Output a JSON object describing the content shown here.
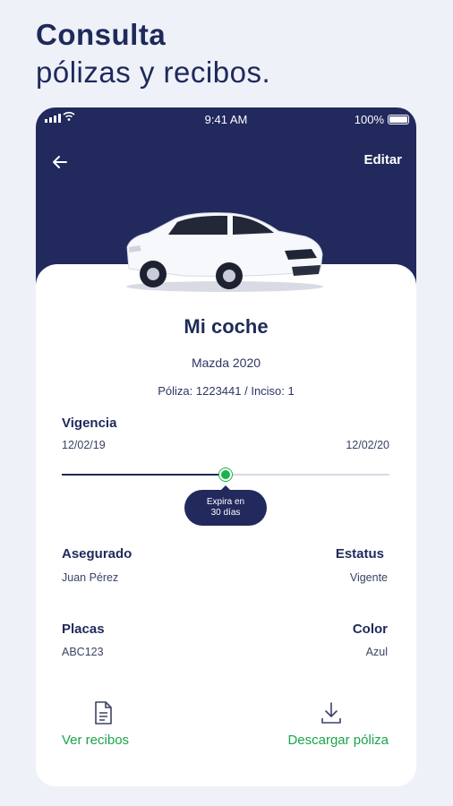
{
  "headline": {
    "line1": "Consulta",
    "line2": "pólizas y recibos."
  },
  "statusbar": {
    "time": "9:41 AM",
    "battery": "100%"
  },
  "header": {
    "edit_label": "Editar"
  },
  "car": {
    "name": "Mi coche",
    "model": "Mazda 2020",
    "policy_line": "Póliza: 1223441  /  Inciso: 1"
  },
  "vigencia": {
    "label": "Vigencia",
    "start": "12/02/19",
    "end": "12/02/20",
    "progress": 0.5,
    "tooltip_line1": "Expira en",
    "tooltip_line2": "30 días"
  },
  "details": {
    "insured_label": "Asegurado",
    "insured_value": "Juan Pérez",
    "status_label": "Estatus",
    "status_value": "Vigente",
    "plates_label": "Placas",
    "plates_value": "ABC123",
    "color_label": "Color",
    "color_value": "Azul"
  },
  "actions": {
    "receipts_label": "Ver recibos",
    "download_label": "Descargar póliza"
  },
  "colors": {
    "navy": "#21295d",
    "green": "#19a54a",
    "background": "#eef1f8"
  }
}
